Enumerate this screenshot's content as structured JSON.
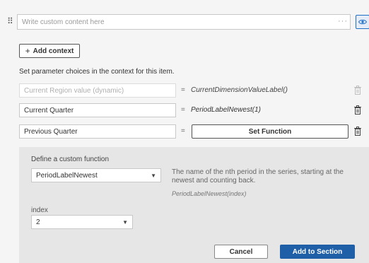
{
  "header": {
    "content_placeholder": "Write custom content here",
    "more_glyph": "···",
    "drag_glyph": "⠿"
  },
  "context": {
    "add_label": "Add context",
    "instructions": "Set parameter choices in the context for this item."
  },
  "parameters": [
    {
      "name": "Current Region value (dynamic)",
      "disabled": true,
      "value": "CurrentDimensionValueLabel()"
    },
    {
      "name": "Current Quarter",
      "disabled": false,
      "value": "PeriodLabelNewest(1)"
    },
    {
      "name": "Previous Quarter",
      "disabled": false,
      "value": "Set Function"
    }
  ],
  "function_panel": {
    "title": "Define a custom function",
    "function_select": "PeriodLabelNewest",
    "description": "The name of the nth period in the series, starting at the newest and counting back.",
    "signature": "PeriodLabelNewest(index)",
    "index_label": "index",
    "index_value": "2",
    "cancel_label": "Cancel",
    "submit_label": "Add to Section"
  },
  "colors": {
    "accent": "#1f5fa8",
    "eye_accent": "#1f6fc5",
    "panel_bg": "#e6e6e6",
    "page_bg": "#f5f5f5"
  },
  "icons": [
    "drag-handle-icon",
    "more-icon",
    "eye-icon",
    "plus-icon",
    "trash-icon",
    "caret-down-icon"
  ]
}
